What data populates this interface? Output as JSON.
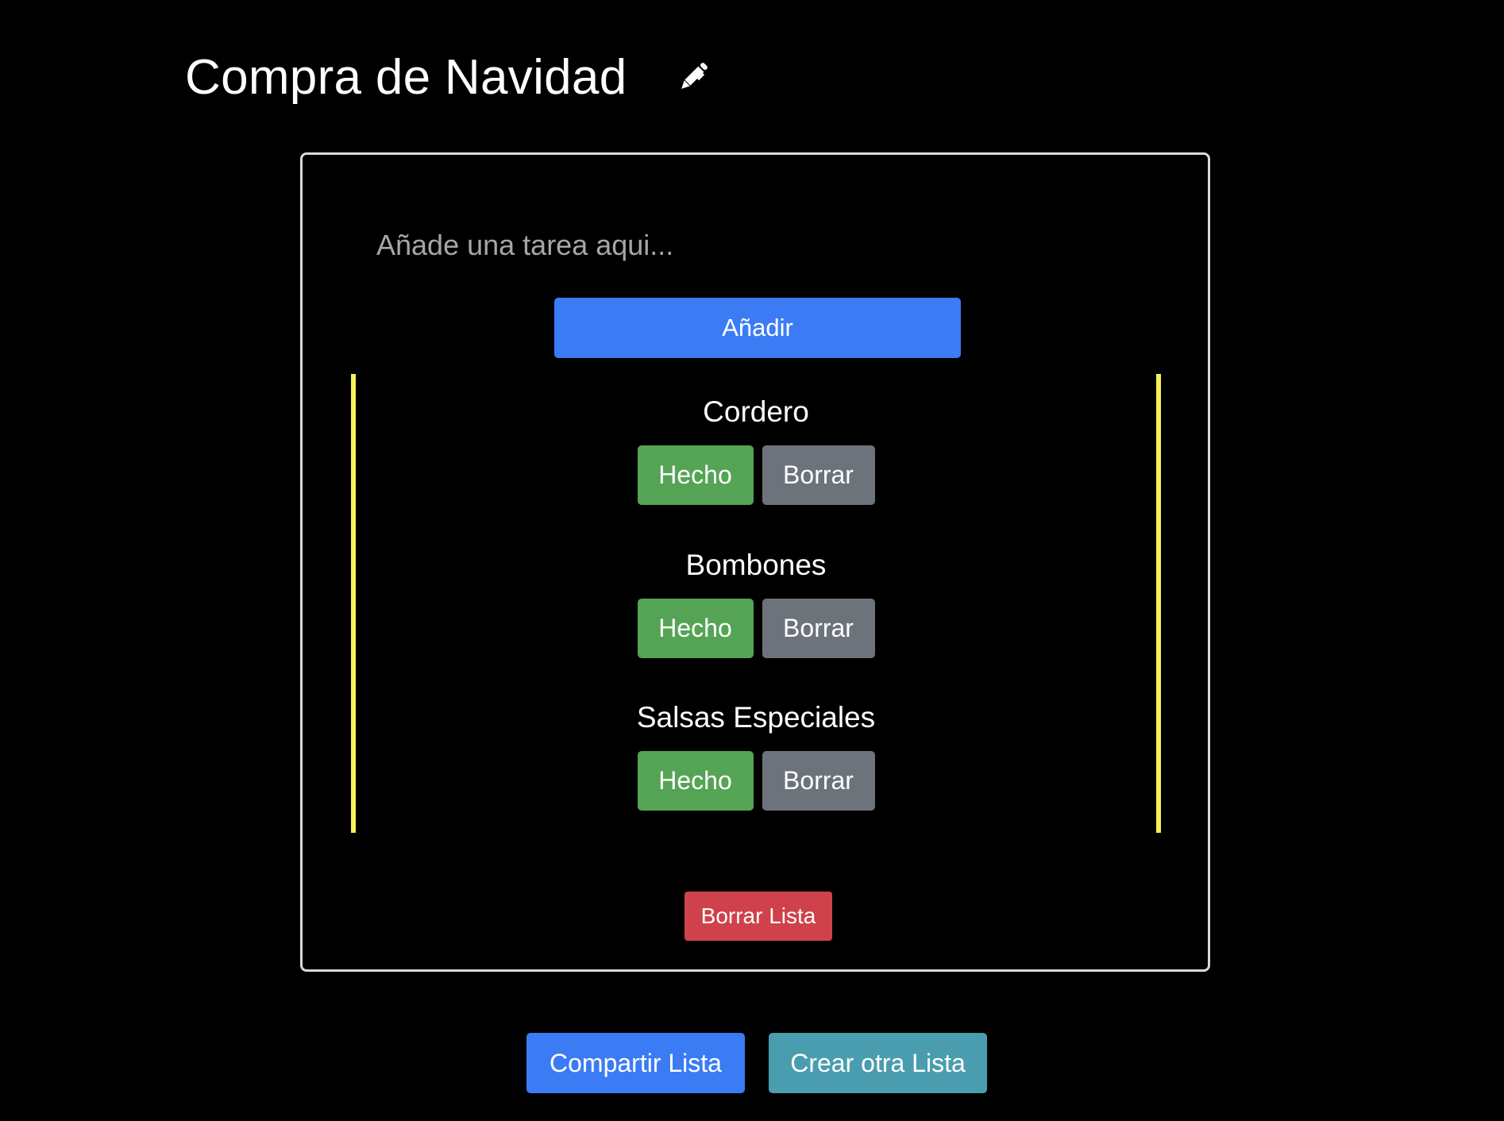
{
  "header": {
    "title": "Compra de Navidad",
    "edit_icon": "pencil-icon"
  },
  "card": {
    "input": {
      "placeholder": "Añade una tarea aqui...",
      "value": ""
    },
    "add_label": "Añadir",
    "tasks": [
      {
        "name": "Cordero",
        "done_label": "Hecho",
        "delete_label": "Borrar"
      },
      {
        "name": "Bombones",
        "done_label": "Hecho",
        "delete_label": "Borrar"
      },
      {
        "name": "Salsas Especiales",
        "done_label": "Hecho",
        "delete_label": "Borrar"
      }
    ],
    "clear_list_label": "Borrar Lista"
  },
  "footer": {
    "share_label": "Compartir Lista",
    "new_list_label": "Crear otra Lista"
  },
  "colors": {
    "background": "#000000",
    "primary": "#3b7cf5",
    "success": "#55a456",
    "secondary": "#6c737b",
    "danger": "#cf424b",
    "info": "#4a9daf",
    "list_border": "#f5f055",
    "card_border": "#d9d9d9"
  }
}
